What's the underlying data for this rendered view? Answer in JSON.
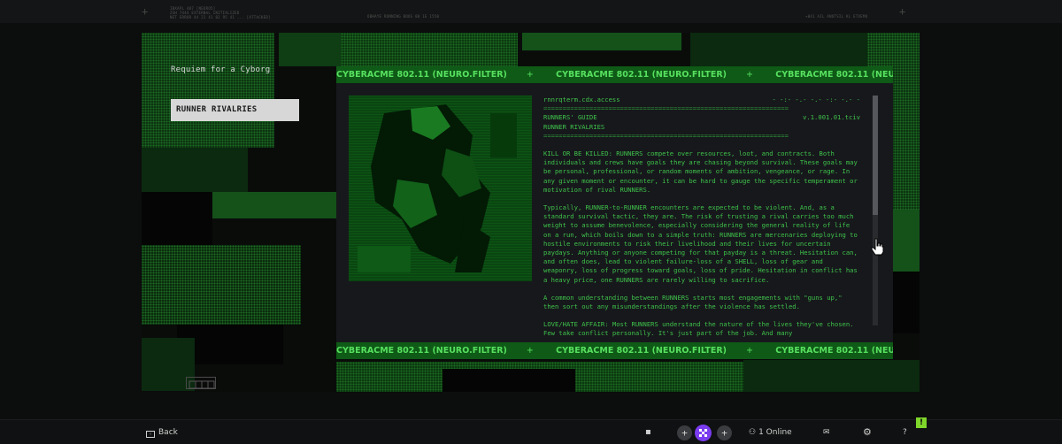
{
  "top_chrome": {
    "left_lines": [
      "IBXAPL 407 [NEURO5]",
      "ZSH 7444 EXTERNAL INITIALIZED",
      "NET ERROR 44 21 41 02 95 41 ... [ATTACKED]"
    ],
    "center_text": "OBHAYE RUNNING BOOS 00 1E 1550",
    "right_text": "+041 AIL ANOTSIL KL ETXEMO"
  },
  "sidebar": {
    "title": "Requiem for a Cyborg",
    "items": [
      {
        "label": "RUNNER RIVALRIES"
      }
    ]
  },
  "marquee": {
    "text": "CYBERACME 802.11 (NEURO.FILTER)",
    "separator": "+"
  },
  "terminal": {
    "access": "rnnrqterm.cdx.access",
    "access_code": "- -:- -.- -.- -:- -.- -",
    "rule": "================================================================",
    "guide": "RUNNERS' GUIDE",
    "version": "v.1.001.01.tciv",
    "section": "RUNNER RIVALRIES",
    "paragraphs": [
      "KILL OR BE KILLED: RUNNERS compete over resources, loot, and contracts. Both individuals and crews have goals they are chasing beyond survival. These goals may be personal, professional, or random moments of ambition, vengeance, or rage. In any given moment or encounter, it can be hard to gauge the specific temperament or motivation of rival RUNNERS.",
      "Typically, RUNNER-to-RUNNER encounters are expected to be violent. And, as a standard survival tactic, they are. The risk of trusting a rival carries too much weight to assume benevolence, especially considering the general reality of life on a run, which boils down to a simple truth: RUNNERS are mercenaries deploying to hostile environments to risk their livelihood and their lives for uncertain paydays. Anything or anyone competing for that payday is a threat. Hesitation can, and often does, lead to violent failure-loss of a SHELL, loss of gear and weaponry, loss of progress toward goals, loss of pride. Hesitation in conflict has a heavy price, one RUNNERS are rarely willing to sacrifice.",
      "A common understanding between RUNNERS starts most engagements with \"guns up,\" then sort out any misunderstandings after the violence has settled.",
      "LOVE/HATE AFFAIR: Most RUNNERS understand the nature of the lives they've chosen. Few take conflict personally. It's just part of the job. And many"
    ]
  },
  "scrollbar": {
    "position_fraction": 0.0,
    "visible_fraction": 0.52
  },
  "bottom_bar": {
    "back_label": "Back",
    "online_label": "1 Online",
    "help_label": "?",
    "alert_label": "!",
    "plus_label": "+"
  },
  "colors": {
    "terminal_green": "#3ec24a",
    "strip_green": "#0e5a16",
    "accent_lime": "#7fd62a",
    "avatar_purple": "#7b3cf0"
  },
  "icons": [
    "back-icon",
    "chat-icon",
    "add-friend-icon",
    "avatar-icon",
    "online-people-icon",
    "mail-icon",
    "settings-gear-icon",
    "help-icon",
    "alert-icon",
    "hand-cursor-icon",
    "hardware-widget-icon"
  ]
}
